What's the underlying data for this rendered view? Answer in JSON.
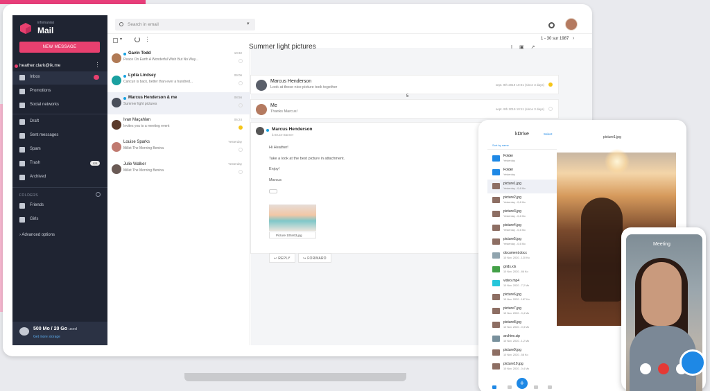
{
  "app": {
    "brand_sub": "infomaniak",
    "brand": "Mail"
  },
  "sidebar": {
    "new_message": "NEW MESSAGE",
    "account": "heather.clark@ik.me",
    "items": [
      {
        "label": "Inbox",
        "icon": "inbox-icon",
        "active": true
      },
      {
        "label": "Promotions",
        "icon": "tag-icon"
      },
      {
        "label": "Social networks",
        "icon": "people-icon"
      },
      {
        "label": "Draft",
        "icon": "draft-icon"
      },
      {
        "label": "Sent messages",
        "icon": "send-icon"
      },
      {
        "label": "Spam",
        "icon": "spam-icon"
      },
      {
        "label": "Trash",
        "icon": "trash-icon",
        "badge": "123"
      },
      {
        "label": "Archived",
        "icon": "archive-icon"
      }
    ],
    "folders_heading": "FOLDERS",
    "folders": [
      "Friends",
      "Girls"
    ],
    "advanced": "Advanced options",
    "quota": "500 Mo / 20 Go",
    "quota_suffix": "used",
    "quota_link": "Get more storage"
  },
  "topbar": {
    "search_placeholder": "Search in email"
  },
  "toolbar": {
    "pager": "1 - 30 sur 1987"
  },
  "list": [
    {
      "name": "Gavin Todd",
      "preview": "Peace On Earth A Wonderful Wish But No Way...",
      "time": "10:32",
      "unread": true,
      "avatar_color": "#b07a55"
    },
    {
      "name": "Lydia Lindsey",
      "preview": "Cancun is back, better than ever a hundred...",
      "time": "09:06",
      "unread": true,
      "avatar_color": "#1aa0a0"
    },
    {
      "name": "Marcus Henderson & me",
      "preview": "Summer light pictures",
      "time": "08:56",
      "unread": true,
      "selected": true,
      "avatar_color": "#4a4f5a"
    },
    {
      "name": "Ivan Maçahlan",
      "preview": "Invites you to a meeting event",
      "time": "06:24",
      "unread": false,
      "avatar_color": "#5a3a2a"
    },
    {
      "name": "Louise Sparks",
      "preview": "Millet The Morning Benina",
      "time": "Yesterday",
      "unread": false,
      "avatar_color": "#c07a70"
    },
    {
      "name": "Julie Walker",
      "preview": "Millet The Morning Benina",
      "time": "Yesterday",
      "unread": false,
      "avatar_color": "#6a5a55"
    }
  ],
  "reading": {
    "subject": "Summer light pictures",
    "messages": [
      {
        "from": "Marcus Henderson",
        "preview": "Look at those nice picture took together",
        "date": "sept. 9th 2019 10:01 (since 3 days)"
      },
      {
        "from": "Me",
        "preview": "Thanks Marcus!",
        "date": "sept. 9th 2019 10:11 (since 3 days)"
      }
    ],
    "collapsed_count": "5",
    "open": {
      "from": "Marcus Henderson",
      "to": "à Bruce Banner",
      "lines": [
        "Hi Heather!",
        "Take a look at the best picture in attachment.",
        "Enjoy!",
        "Marcus"
      ],
      "attachment": "Picture 105463.jpg",
      "reply": "REPLY",
      "forward": "FORWARD"
    }
  },
  "kdrive": {
    "title": "kDrive",
    "select": "Select",
    "sort": "Sort by name",
    "files": [
      {
        "name": "Folder",
        "meta": "Yesterday",
        "type": "folder"
      },
      {
        "name": "Folder",
        "meta": "Yesterday",
        "type": "folder"
      },
      {
        "name": "picture1.jpg",
        "meta": "Yesterday - 0,4 Mo",
        "type": "image",
        "selected": true
      },
      {
        "name": "picture2.jpg",
        "meta": "Yesterday - 0,4 Mo",
        "type": "image"
      },
      {
        "name": "picture3.jpg",
        "meta": "Yesterday - 0,4 Mo",
        "type": "image"
      },
      {
        "name": "picture4.jpg",
        "meta": "Yesterday - 0,4 Mo",
        "type": "image"
      },
      {
        "name": "picture5.jpg",
        "meta": "Yesterday - 0,4 Mo",
        "type": "image"
      },
      {
        "name": "document.docx",
        "meta": "10 Nov. 2020 - 120 Ko",
        "type": "doc"
      },
      {
        "name": "grids.xls",
        "meta": "10 Nov. 2020 - 86 Ko",
        "type": "sheet"
      },
      {
        "name": "video.mp4",
        "meta": "10 Nov. 2020 - 7,2 Mo",
        "type": "video"
      },
      {
        "name": "picture6.jpg",
        "meta": "10 Nov. 2020 - 187 Ko",
        "type": "image"
      },
      {
        "name": "picture7.jpg",
        "meta": "10 Nov. 2020 - 0,4 Mo",
        "type": "image"
      },
      {
        "name": "picture8.jpg",
        "meta": "10 Nov. 2020 - 0,3 Mo",
        "type": "image"
      },
      {
        "name": "archive.zip",
        "meta": "10 Nov. 2020 - 1,2 Mo",
        "type": "archive"
      },
      {
        "name": "picture9.jpg",
        "meta": "10 Nov. 2020 - 58 Ko",
        "type": "image"
      },
      {
        "name": "picture10.jpg",
        "meta": "10 Nov. 2020 - 0,4 Mo",
        "type": "image"
      }
    ],
    "preview_title": "picture1.jpg"
  },
  "phone": {
    "title": "Meeting"
  },
  "colors": {
    "accent": "#e8406f",
    "sidebar": "#1f2432",
    "link": "#1e88e5"
  }
}
